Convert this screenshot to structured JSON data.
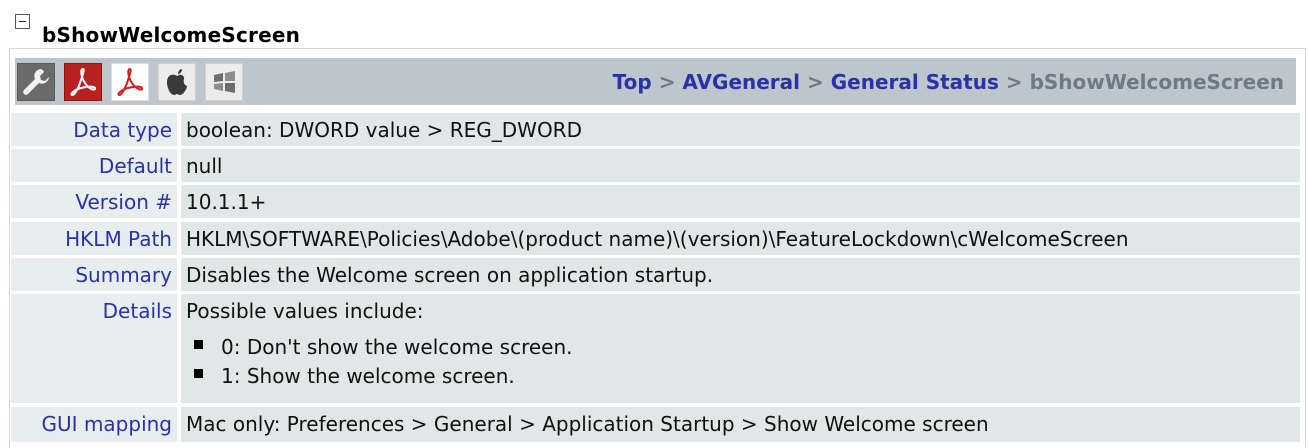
{
  "section": {
    "title": "bShowWelcomeScreen"
  },
  "toolbar": {
    "icons": [
      {
        "name": "wrench-icon",
        "bg": "#5a5a5a"
      },
      {
        "name": "acrobat-icon",
        "bg": "#b0201e"
      },
      {
        "name": "reader-icon",
        "bg": "#ffffff"
      },
      {
        "name": "apple-icon",
        "bg": "#e6e6e6"
      },
      {
        "name": "windows-icon",
        "bg": "#e6e6e6"
      }
    ]
  },
  "breadcrumb": {
    "items": [
      "Top",
      "AVGeneral",
      "General Status"
    ],
    "separator": ">",
    "current": "bShowWelcomeScreen"
  },
  "rows": {
    "data_type": {
      "label": "Data type",
      "value": "boolean: DWORD value > REG_DWORD"
    },
    "default": {
      "label": "Default",
      "value": "null"
    },
    "version": {
      "label": "Version #",
      "value": "10.1.1+"
    },
    "hklm_path": {
      "label": "HKLM Path",
      "value": "HKLM\\SOFTWARE\\Policies\\Adobe\\(product name)\\(version)\\FeatureLockdown\\cWelcomeScreen"
    },
    "summary": {
      "label": "Summary",
      "value": "Disables the Welcome screen on application startup."
    },
    "details": {
      "label": "Details",
      "intro": "Possible values include:",
      "items": [
        "0: Don't show the welcome screen.",
        "1: Show the welcome screen."
      ]
    },
    "gui_mapping": {
      "label": "GUI mapping",
      "value": "Mac only: Preferences > General > Application Startup > Show Welcome screen"
    }
  },
  "colors": {
    "link": "#2b31a8",
    "toolbar_bg": "#bdc6cd",
    "label_bg": "#e8eeee",
    "value_bg": "#e0e7e7"
  }
}
